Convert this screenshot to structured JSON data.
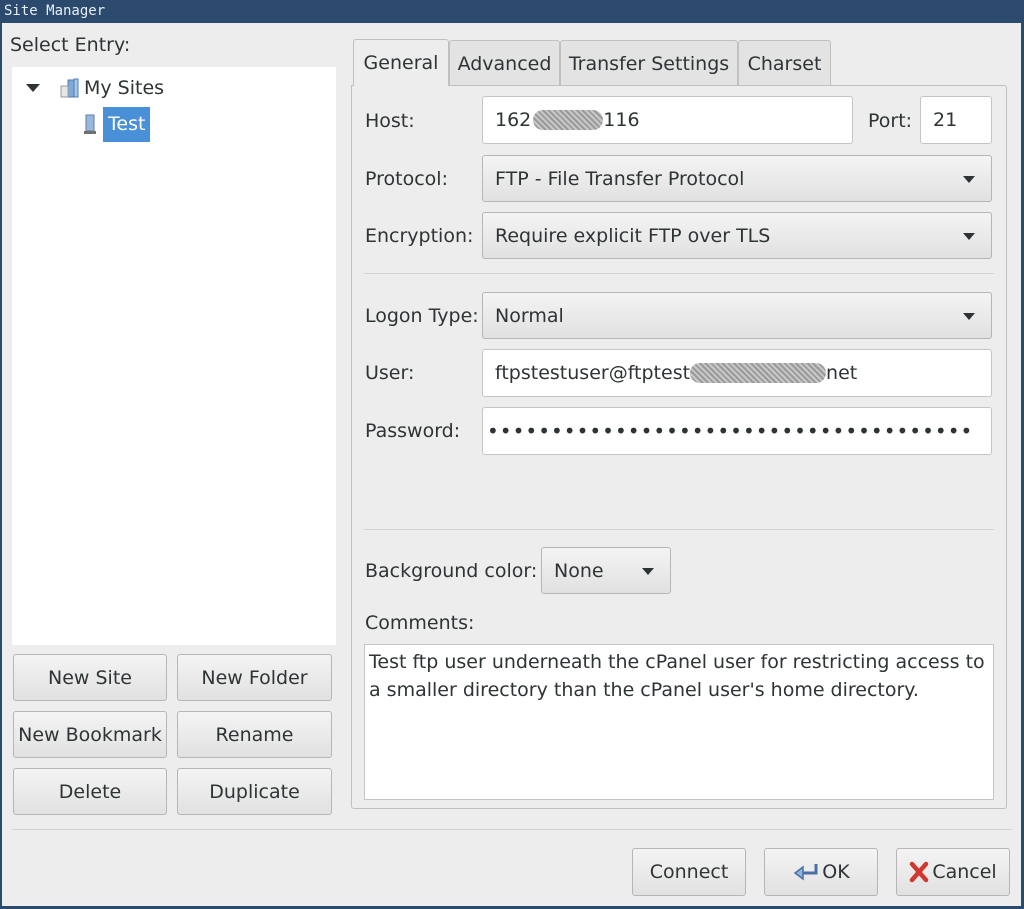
{
  "window": {
    "title": "Site Manager"
  },
  "left": {
    "select_entry_label": "Select Entry:",
    "tree": [
      {
        "label": "My Sites",
        "icon": "folder-icon",
        "expanded": true
      },
      {
        "label": "Test",
        "icon": "server-icon",
        "selected": true
      }
    ],
    "buttons": {
      "new_site": "New Site",
      "new_folder": "New Folder",
      "new_bookmark": "New Bookmark",
      "rename": "Rename",
      "delete": "Delete",
      "duplicate": "Duplicate"
    }
  },
  "tabs": [
    {
      "label": "General",
      "active": true
    },
    {
      "label": "Advanced",
      "active": false
    },
    {
      "label": "Transfer Settings",
      "active": false
    },
    {
      "label": "Charset",
      "active": false
    }
  ],
  "general": {
    "host_label": "Host:",
    "host_prefix": "162",
    "host_suffix": "116",
    "port_label": "Port:",
    "port_value": "21",
    "protocol_label": "Protocol:",
    "protocol_value": "FTP - File Transfer Protocol",
    "encryption_label": "Encryption:",
    "encryption_value": "Require explicit FTP over TLS",
    "logon_type_label": "Logon Type:",
    "logon_type_value": "Normal",
    "user_label": "User:",
    "user_prefix": "ftpstestuser@ftptest",
    "user_suffix": "net",
    "password_label": "Password:",
    "password_value": "••••••••••••••••••••••••••••••••••••••",
    "bg_color_label": "Background color:",
    "bg_color_value": "None",
    "comments_label": "Comments:",
    "comments_value": "Test ftp user underneath the cPanel user for restricting access to a smaller directory than the cPanel user's home directory."
  },
  "footer": {
    "connect": "Connect",
    "ok": "OK",
    "cancel": "Cancel"
  },
  "colors": {
    "titlebar": "#2b4a6e",
    "selection": "#4a90d9",
    "dialog_bg": "#ededed"
  }
}
